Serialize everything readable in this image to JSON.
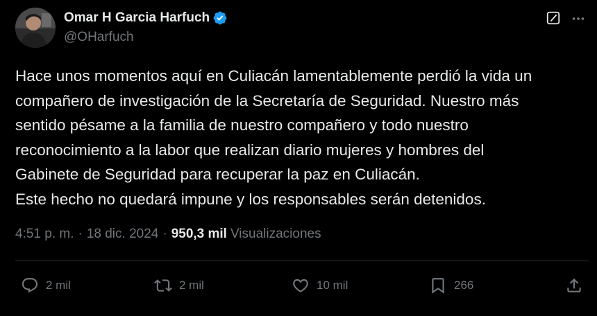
{
  "author": {
    "display_name": "Omar H Garcia Harfuch",
    "handle": "@OHarfuch",
    "verified": true
  },
  "tweet": {
    "lines": [
      "Hace unos momentos aquí en Culiacán lamentablemente perdió la vida un",
      "compañero de investigación de la Secretaría de Seguridad. Nuestro más",
      "sentido pésame a la familia de nuestro compañero y todo nuestro",
      "reconocimiento a la labor que realizan diario mujeres y hombres del",
      "Gabinete de Seguridad para recuperar la paz en Culiacán.",
      "Este hecho no quedará impune y los responsables serán detenidos."
    ]
  },
  "meta": {
    "time": "4:51 p. m.",
    "separator": "·",
    "date": "18 dic. 2024",
    "views_count": "950,3 mil",
    "views_label": "Visualizaciones"
  },
  "actions": {
    "replies": "2 mil",
    "reposts": "2 mil",
    "likes": "10 mil",
    "bookmarks": "266"
  },
  "colors": {
    "background": "#000000",
    "text_primary": "#e7e9ea",
    "text_secondary": "#71767b",
    "verified_blue": "#1d9bf0",
    "divider": "#2f3336"
  },
  "icons": {
    "verified": "verified-badge-icon",
    "grok": "grok-icon",
    "more": "more-icon",
    "reply": "reply-icon",
    "repost": "repost-icon",
    "like": "like-icon",
    "bookmark": "bookmark-icon",
    "share": "share-icon"
  }
}
